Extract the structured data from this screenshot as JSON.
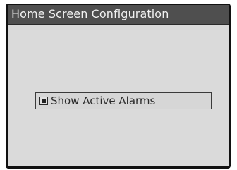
{
  "window": {
    "title": "Home Screen Configuration"
  },
  "options": {
    "show_active_alarms": {
      "label": "Show Active Alarms",
      "checked": true
    }
  },
  "colors": {
    "titlebar": "#4f4f4f",
    "content_background": "#dadada",
    "frame": "#111111"
  }
}
